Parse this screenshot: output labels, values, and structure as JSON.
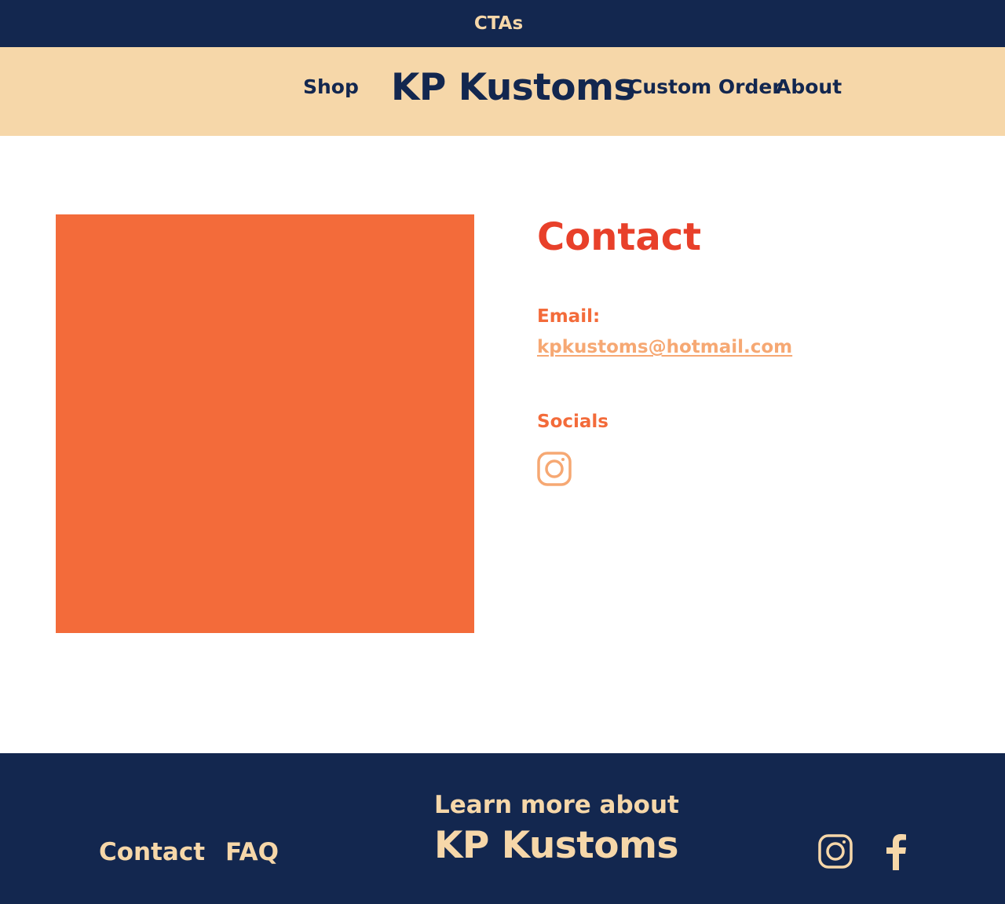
{
  "top_bar": {
    "label": "CTAs"
  },
  "nav": {
    "shop": "Shop",
    "brand": "KP Kustoms",
    "custom_order": "Custom Order",
    "about": "About"
  },
  "contact": {
    "title": "Contact",
    "email_label": "Email:",
    "email": "kpkustoms@hotmail.com",
    "socials_label": "Socials",
    "social_icons": [
      "instagram-icon"
    ]
  },
  "footer": {
    "links": {
      "contact": "Contact",
      "faq": "FAQ"
    },
    "learn_more": "Learn more about",
    "brand": "KP Kustoms",
    "social_icons": [
      "instagram-icon",
      "facebook-icon"
    ]
  },
  "colors": {
    "navy": "#13274f",
    "cream": "#f6d7a9",
    "orange": "#f36b3a",
    "red": "#e8402a",
    "peach": "#f6a873"
  }
}
